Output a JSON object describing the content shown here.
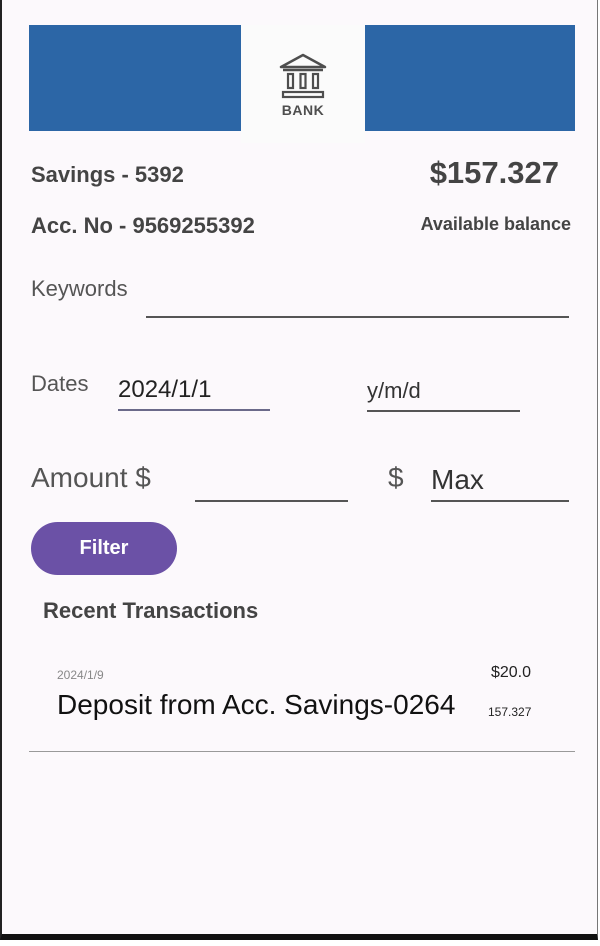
{
  "header": {
    "logo_text": "BANK",
    "accent_color": "#2c66a6"
  },
  "account": {
    "name": "Savings - 5392",
    "number": "Acc. No - 9569255392",
    "balance": "$157.327",
    "balance_caption": "Available balance"
  },
  "filters": {
    "keywords_label": "Keywords",
    "keywords_value": "",
    "dates_label": "Dates",
    "date_from_value": "2024/1/1",
    "date_to_placeholder": "y/m/d",
    "amount_label": "Amount $",
    "amount_min_value": "",
    "amount_max_currency": "$",
    "amount_max_placeholder": "Max",
    "filter_button_label": "Filter",
    "button_color": "#6b51a6"
  },
  "transactions": {
    "title": "Recent Transactions",
    "items": [
      {
        "date": "2024/1/9",
        "amount": "$20.0",
        "description": "Deposit from Acc. Savings-0264",
        "balance_after": "157.327"
      }
    ]
  }
}
